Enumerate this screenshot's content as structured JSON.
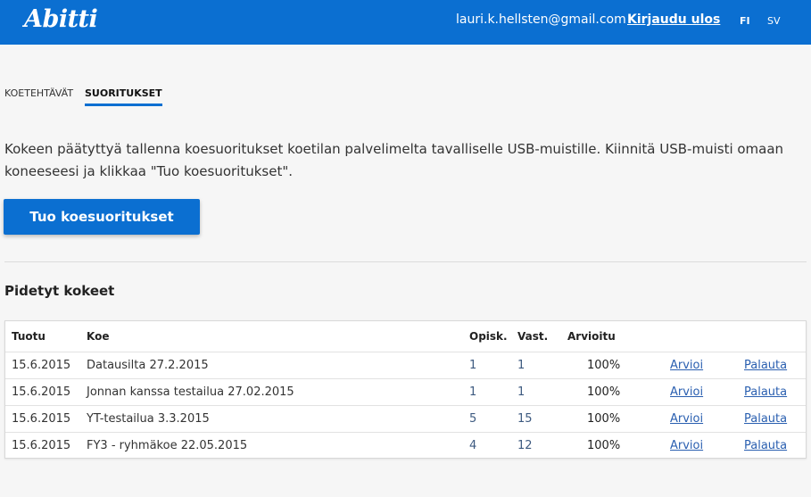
{
  "header": {
    "logo": "Abitti",
    "email": "lauri.k.hellsten@gmail.com",
    "logout": "Kirjaudu ulos",
    "lang_fi": "FI",
    "lang_sv": "SV"
  },
  "tabs": [
    {
      "label": "KOETEHTÄVÄT",
      "active": false
    },
    {
      "label": "SUORITUKSET",
      "active": true
    }
  ],
  "intro_text": "Kokeen päätyttyä tallenna koesuoritukset koetilan palvelimelta tavalliselle USB-muistille. Kiinnitä USB-muisti omaan koneeseesi ja klikkaa \"Tuo koesuoritukset\".",
  "import_button": "Tuo koesuoritukset",
  "section_title": "Pidetyt kokeet",
  "table": {
    "headers": [
      "Tuotu",
      "Koe",
      "Opisk.",
      "Vast.",
      "Arvioitu"
    ],
    "rows": [
      {
        "imported": "15.6.2015",
        "exam": "Datausilta 27.2.2015",
        "students": "1",
        "answers": "1",
        "graded": "100%",
        "grade_link": "Arvioi",
        "return_link": "Palauta"
      },
      {
        "imported": "15.6.2015",
        "exam": "Jonnan kanssa testailua 27.02.2015",
        "students": "1",
        "answers": "1",
        "graded": "100%",
        "grade_link": "Arvioi",
        "return_link": "Palauta"
      },
      {
        "imported": "15.6.2015",
        "exam": "YT-testailua 3.3.2015",
        "students": "5",
        "answers": "15",
        "graded": "100%",
        "grade_link": "Arvioi",
        "return_link": "Palauta"
      },
      {
        "imported": "15.6.2015",
        "exam": "FY3 - ryhmäkoe 22.05.2015",
        "students": "4",
        "answers": "12",
        "graded": "100%",
        "grade_link": "Arvioi",
        "return_link": "Palauta"
      }
    ]
  },
  "colors": {
    "brand_blue": "#0b6fd1",
    "link": "#2a5fb0"
  }
}
